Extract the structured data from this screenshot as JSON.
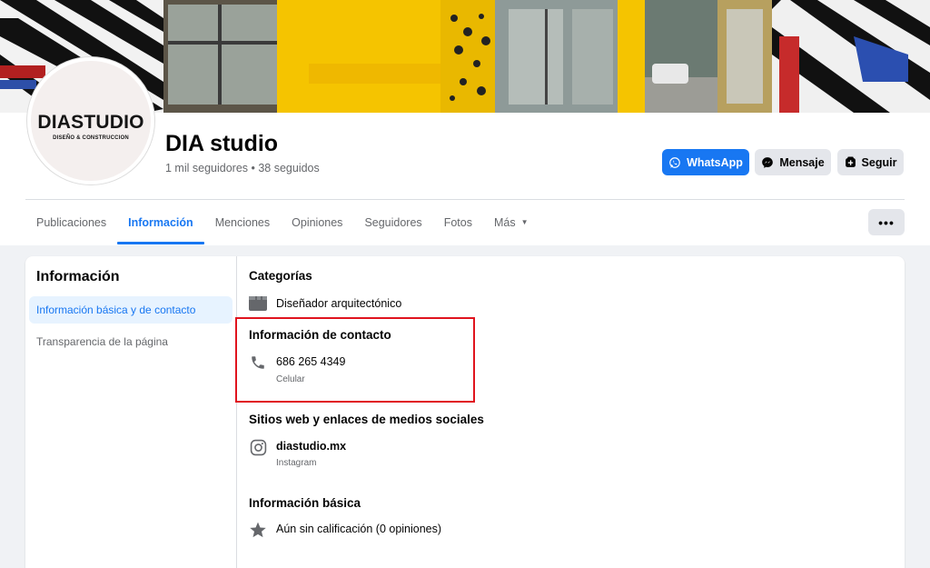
{
  "page": {
    "name": "DIA studio",
    "stats": "1 mil seguidores • 38 seguidos",
    "avatar_brand": "DIASTUDIO",
    "avatar_tagline": "DISEÑO & CONSTRUCCION"
  },
  "actions": {
    "whatsapp_label": "WhatsApp",
    "message_label": "Mensaje",
    "follow_label": "Seguir",
    "more_label": "•••"
  },
  "tabs": [
    {
      "label": "Publicaciones"
    },
    {
      "label": "Información"
    },
    {
      "label": "Menciones"
    },
    {
      "label": "Opiniones"
    },
    {
      "label": "Seguidores"
    },
    {
      "label": "Fotos"
    },
    {
      "label": "Más"
    }
  ],
  "sidebar": {
    "title": "Información",
    "items": [
      {
        "label": "Información básica y de contacto"
      },
      {
        "label": "Transparencia de la página"
      }
    ]
  },
  "about": {
    "categories": {
      "title": "Categorías",
      "value": "Diseñador arquitectónico"
    },
    "contact": {
      "title": "Información de contacto",
      "phone": "686 265 4349",
      "phone_type": "Celular"
    },
    "social": {
      "title": "Sitios web y enlaces de medios sociales",
      "handle": "diastudio.mx",
      "network": "Instagram"
    },
    "basic": {
      "title": "Información básica",
      "rating": "Aún sin calificación (0 opiniones)"
    }
  },
  "colors": {
    "accent": "#1877f2",
    "highlight": "#e0141e",
    "cover_yellow": "#f5c400"
  }
}
